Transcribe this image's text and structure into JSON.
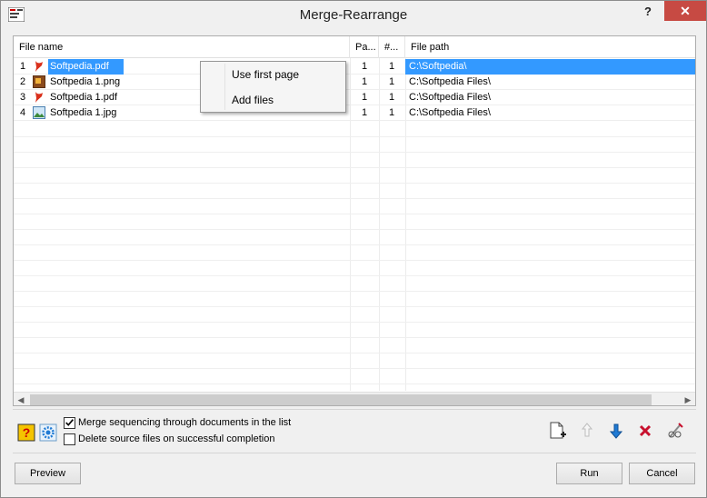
{
  "window": {
    "title": "Merge-Rearrange",
    "help_label": "?",
    "close_label": "✕"
  },
  "list": {
    "columns": [
      "File name",
      "Pa...",
      "#...",
      "File path"
    ],
    "rows": [
      {
        "index": "1",
        "name": "Softpedia.pdf",
        "type": "pdf",
        "pages": "1",
        "num": "1",
        "path": "C:\\Softpedia\\",
        "selected": true
      },
      {
        "index": "2",
        "name": "Softpedia 1.png",
        "type": "png",
        "pages": "1",
        "num": "1",
        "path": "C:\\Softpedia Files\\",
        "selected": false
      },
      {
        "index": "3",
        "name": "Softpedia 1.pdf",
        "type": "pdf",
        "pages": "1",
        "num": "1",
        "path": "C:\\Softpedia Files\\",
        "selected": false
      },
      {
        "index": "4",
        "name": "Softpedia 1.jpg",
        "type": "jpg",
        "pages": "1",
        "num": "1",
        "path": "C:\\Softpedia Files\\",
        "selected": false
      }
    ]
  },
  "context_menu": {
    "items": [
      "Use first page",
      "Add files"
    ]
  },
  "options": {
    "merge_sequencing": {
      "label": "Merge sequencing through documents in the list",
      "checked": true
    },
    "delete_source": {
      "label": "Delete source files on successful completion",
      "checked": false
    }
  },
  "buttons": {
    "preview": "Preview",
    "run": "Run",
    "cancel": "Cancel"
  },
  "colors": {
    "selection": "#3399ff",
    "close": "#c74a43",
    "pdf_icon": "#d9301c",
    "arrow_blue": "#1f7ad4",
    "delete_red": "#c8102e"
  }
}
